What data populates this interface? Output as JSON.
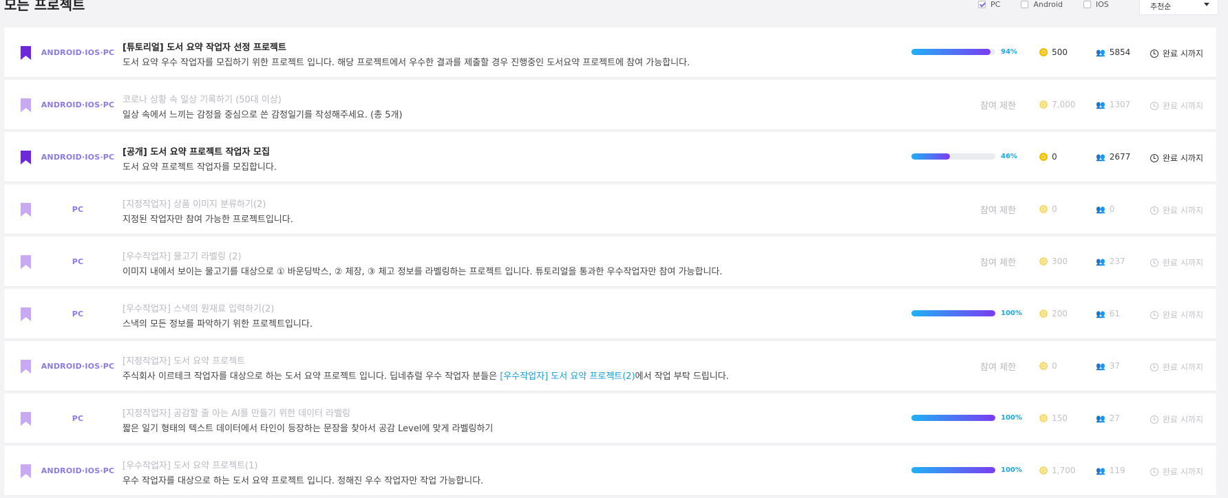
{
  "header": {
    "title": "모든 프로젝트",
    "filters": [
      {
        "label": "PC",
        "checked": true
      },
      {
        "label": "Android",
        "checked": false
      },
      {
        "label": "IOS",
        "checked": false
      }
    ],
    "sort": {
      "selected": "추천순"
    }
  },
  "colors": {
    "bookmark_active": "#6d28d9",
    "bookmark_inactive": "#c7aaf2",
    "accent": "#8a7ae8",
    "progress_start": "#1fb1f5",
    "progress_end": "#7b3cf2",
    "pct_text": "#19a6e3",
    "link": "#1a9fd6",
    "coin": "#f2c200"
  },
  "projects": [
    {
      "platform": "ANDROID·IOS·PC",
      "title": "[튜토리얼] 도서 요약 작업자 선정 프로젝트",
      "description": "도서 요약 우수 작업자를 모집하기 위한 프로젝트 입니다. 해당 프로젝트에서 우수한 결과를 제출할 경우 진행중인 도서요약 프로젝트에 참여 가능합니다.",
      "active": true,
      "progress": 94,
      "progress_label": "94%",
      "points": "500",
      "participants": "5854",
      "deadline": "완료 시까지"
    },
    {
      "platform": "ANDROID·IOS·PC",
      "title": "코로나 상황 속 일상 기록하기 (50대 이상)",
      "description": "일상 속에서 느끼는 감정을 중심으로 쓴 감정일기를 작성해주세요. (총 5개)",
      "active": false,
      "restricted_label": "참여 제한",
      "points": "7,000",
      "participants": "1307",
      "deadline": "완료 시까지"
    },
    {
      "platform": "ANDROID·IOS·PC",
      "title": "[공개] 도서 요약 프로젝트 작업자 모집",
      "description": "도서 요약 프로젝트 작업자를 모집합니다.",
      "active": true,
      "progress": 46,
      "progress_label": "46%",
      "points": "0",
      "participants": "2677",
      "deadline": "완료 시까지"
    },
    {
      "platform": "PC",
      "title": "[지정작업자] 상품 이미지 분류하기(2)",
      "description": "지정된 작업자만 참여 가능한 프로젝트입니다.",
      "active": false,
      "restricted_label": "참여 제한",
      "points": "0",
      "participants": "0",
      "deadline": "완료 시까지"
    },
    {
      "platform": "PC",
      "title": "[우수작업자] 물고기 라벨링 (2)",
      "description": "이미지 내에서 보이는 물고기를 대상으로 ① 바운딩박스, ② 체장, ③ 체고 정보를 라벨링하는 프로젝트 입니다. 튜토리얼을 통과한 우수작업자만 참여 가능합니다.",
      "active": false,
      "restricted_label": "참여 제한",
      "points": "300",
      "participants": "237",
      "deadline": "완료 시까지"
    },
    {
      "platform": "PC",
      "title": "[우수작업자] 스낵의 원재료 입력하기(2)",
      "description": "스낵의 모든 정보를 파악하기 위한 프로젝트입니다.",
      "active": false,
      "progress": 100,
      "progress_label": "100%",
      "points": "200",
      "participants": "61",
      "deadline": "완료 시까지"
    },
    {
      "platform": "ANDROID·IOS·PC",
      "title": "[지정작업자] 도서 요약 프로젝트",
      "description_before": "주식회사 이르테크 작업자를 대상으로 하는 도서 요약 프로젝트 입니다. 딥네츄럴 우수 작업자 분들은 ",
      "description_link": "[우수작업자] 도서 요약 프로젝트(2)",
      "description_after": "에서 작업 부탁 드립니다.",
      "active": false,
      "restricted_label": "참여 제한",
      "points": "0",
      "participants": "37",
      "deadline": "완료 시까지"
    },
    {
      "platform": "PC",
      "title": "[지정작업자] 공감할 줄 아는 AI를 만들기 위한 데이터 라벨링",
      "description": "짧은 일기 형태의 텍스트 데이터에서 타인이 등장하는 문장을 찾아서 공감 Level에 맞게 라벨링하기",
      "active": false,
      "progress": 100,
      "progress_label": "100%",
      "points": "150",
      "participants": "27",
      "deadline": "완료 시까지"
    },
    {
      "platform": "ANDROID·IOS·PC",
      "title": "[우수작업자] 도서 요약 프로젝트(1)",
      "description": "우수 작업자를 대상으로 하는 도서 요약 프로젝트 입니다. 정해진 우수 작업자만 작업 가능합니다.",
      "active": false,
      "progress": 100,
      "progress_label": "100%",
      "points": "1,700",
      "participants": "119",
      "deadline": "완료 시까지"
    }
  ]
}
